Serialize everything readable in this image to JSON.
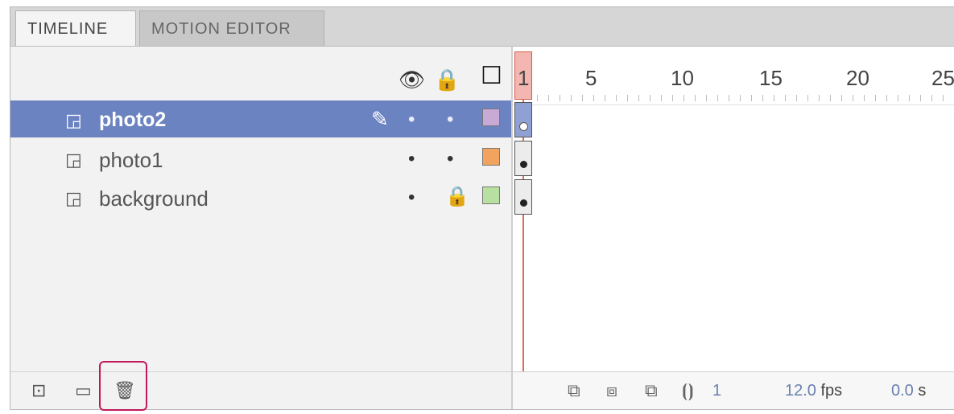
{
  "tabs": [
    {
      "label": "TIMELINE"
    },
    {
      "label": "MOTION EDITOR"
    }
  ],
  "header_icons": {
    "eye": "👁",
    "lock": "🔒",
    "outline": "☐"
  },
  "ruler": {
    "labels": [
      "1",
      "5",
      "10",
      "15",
      "20",
      "25"
    ]
  },
  "layers": [
    {
      "name": "photo2",
      "selected": true,
      "color": "#c9a9d6",
      "locked": false,
      "editing": true
    },
    {
      "name": "photo1",
      "selected": false,
      "color": "#f2a35d",
      "locked": false,
      "editing": false
    },
    {
      "name": "background",
      "selected": false,
      "color": "#b8e0a0",
      "locked": true,
      "editing": false
    }
  ],
  "glyphs": {
    "layer_icon": "◲",
    "pencil": "✎",
    "dot": "•",
    "lock": "🔒",
    "new_layer": "⊡",
    "new_folder": "▭",
    "delete": "🗑"
  },
  "frame_bar": {
    "current_frame": "1",
    "fps_value": "12.0",
    "fps_unit": "fps",
    "time_value": "0.0",
    "time_unit": "s"
  }
}
